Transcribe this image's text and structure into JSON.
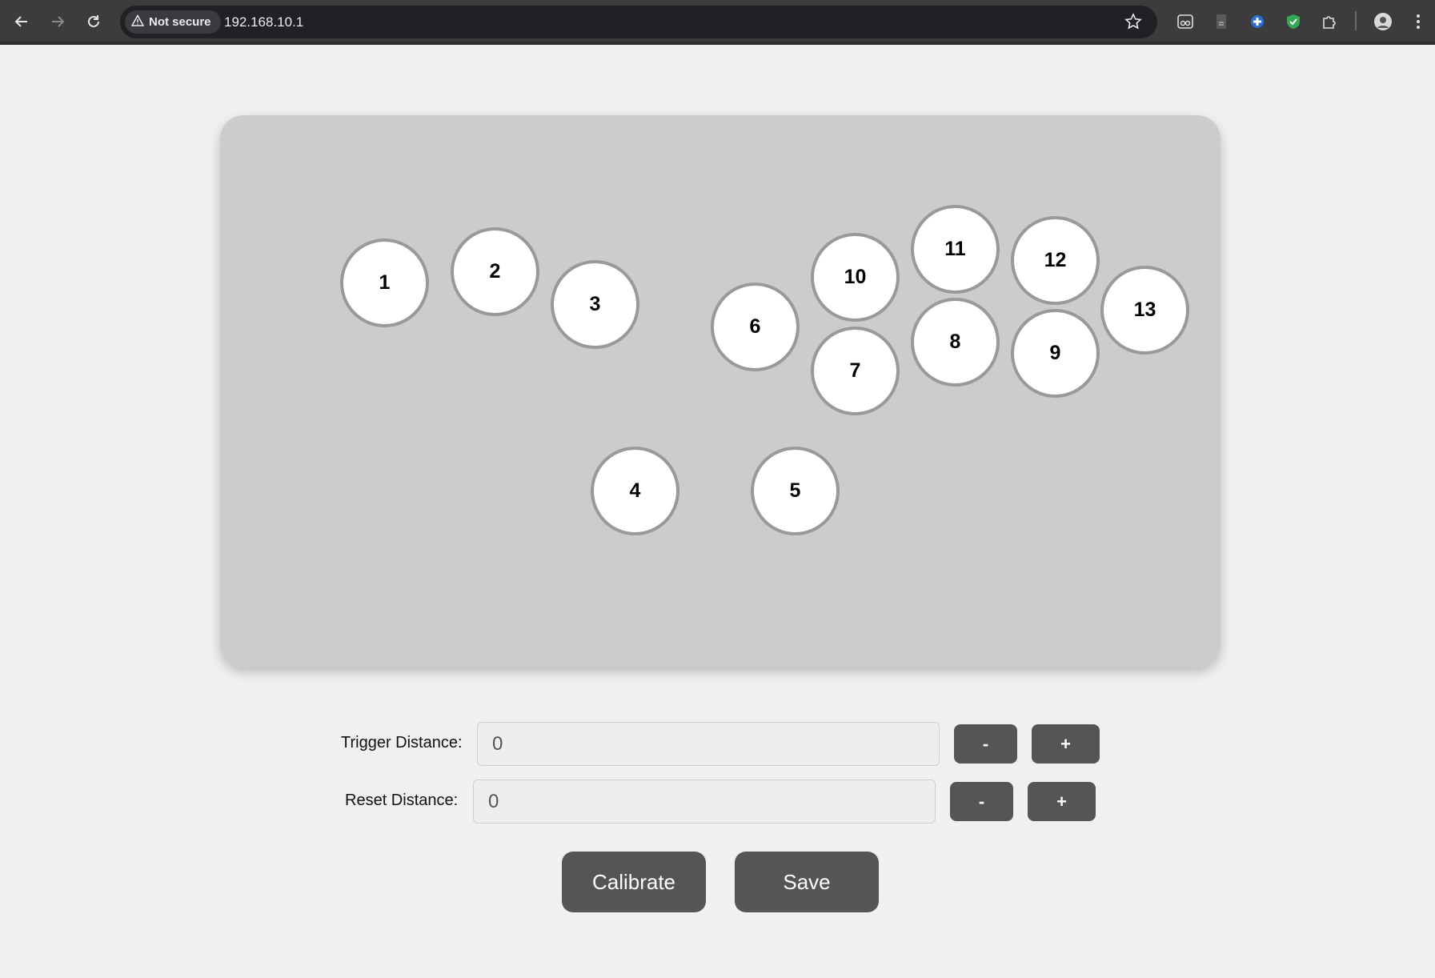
{
  "browser": {
    "security_label": "Not secure",
    "url": "192.168.10.1"
  },
  "pad": {
    "buttons": [
      "1",
      "2",
      "3",
      "4",
      "5",
      "6",
      "7",
      "8",
      "9",
      "10",
      "11",
      "12",
      "13"
    ]
  },
  "form": {
    "trigger": {
      "label": "Trigger Distance:",
      "value": "0",
      "minus": "-",
      "plus": "+"
    },
    "reset": {
      "label": "Reset Distance:",
      "value": "0",
      "minus": "-",
      "plus": "+"
    }
  },
  "actions": {
    "calibrate": "Calibrate",
    "save": "Save"
  },
  "colors": {
    "accent_button": "#555555",
    "pad_background": "#cccccc",
    "page_background": "#f0f0f0"
  }
}
